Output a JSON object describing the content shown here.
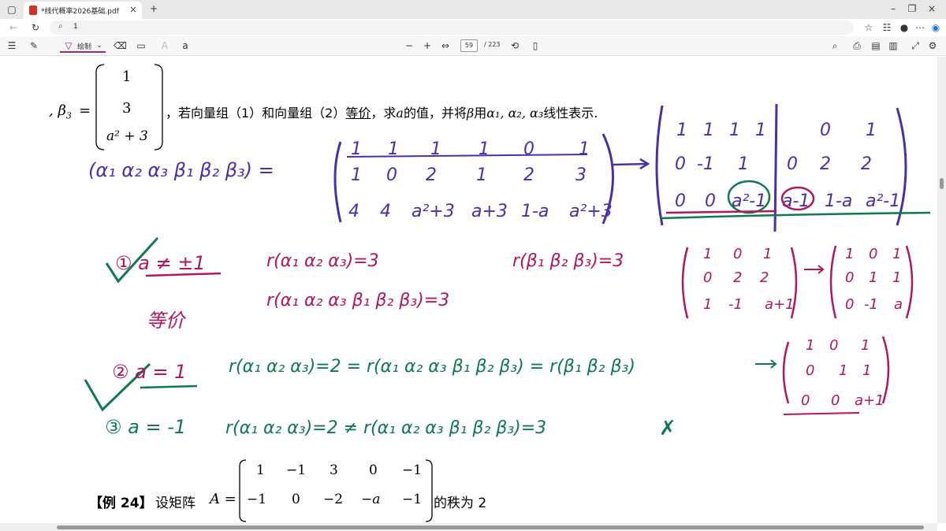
{
  "browser": {
    "tab_title": "*线代概率2026基础.pdf",
    "address": "1"
  },
  "toolbar": {
    "draw_label": "绘制",
    "page_number": "59",
    "page_total": "/ 223"
  },
  "document": {
    "line1_pre": ", β",
    "line1_sub": "3",
    "line1_eq": "=",
    "matrix_beta3": [
      "1",
      "3",
      "a² + 3"
    ],
    "line1_text": "，若向量组（1）和向量组（2）",
    "line1_underlined": "等价",
    "line1_text2": "，求",
    "line1_a": "a",
    "line1_text3": "的值，并将",
    "line1_beta": "β",
    "line1_text4": "用",
    "line1_alphas": "α₁, α₂, α₃",
    "line1_text5": "线性表示.",
    "example_label": "【例 24】",
    "example_text": "设矩阵",
    "example_A": "A =",
    "example_row1": [
      "1",
      "−1",
      "3",
      "0",
      "−1"
    ],
    "example_row2": [
      "−1",
      "0",
      "−2",
      "−a",
      "−1"
    ],
    "example_end": "的秩为 2"
  },
  "handwriting": {
    "blue_lhs": "(α₁ α₂ α₃ β₁ β₂ β₃) =",
    "blue_row1": [
      "1",
      "1",
      "1",
      "1",
      "0",
      "1"
    ],
    "blue_row2": [
      "1",
      "0",
      "2",
      "1",
      "2",
      "3"
    ],
    "blue_row3": [
      "4",
      "4",
      "a²+3",
      "a+3",
      "1-a",
      "a²+3"
    ],
    "ech_row1": [
      "1",
      "1",
      "1",
      "1",
      "0",
      "1"
    ],
    "ech_row2": [
      "0",
      "-1",
      "1",
      "0",
      "2",
      "2"
    ],
    "ech_row3": [
      "0",
      "0",
      "a²-1",
      "a-1",
      "1-a",
      "a²-1"
    ],
    "case1": "① a ≠ ±1",
    "case1_r1": "r(α₁ α₂ α₃)=3",
    "case1_r2": "r(β₁ β₂ β₃)=3",
    "case1_r3": "r(α₁ α₂ α₃ β₁ β₂ β₃)=3",
    "case1_note": "等价",
    "m1_row1": [
      "1",
      "0",
      "1"
    ],
    "m1_row2": [
      "0",
      "2",
      "2"
    ],
    "m1_row3": [
      "1",
      "-1",
      "a+1"
    ],
    "m2_row1": [
      "1",
      "0",
      "1"
    ],
    "m2_row2": [
      "0",
      "1",
      "1"
    ],
    "m2_row3": [
      "0",
      "-1",
      "a"
    ],
    "case2": "② a = 1",
    "case2_eq": "r(α₁ α₂ α₃)=2 = r(α₁ α₂ α₃ β₁ β₂ β₃) = r(β₁ β₂ β₃)",
    "m3_row1": [
      "1",
      "0",
      "1"
    ],
    "m3_row2": [
      "0",
      "1",
      "1"
    ],
    "m3_row3": [
      "0",
      "0",
      "a+1"
    ],
    "case3": "③ a = -1",
    "case3_eq": "r(α₁ α₂ α₃)=2 ≠ r(α₁ α₂ α₃ β₁ β₂ β₃)=3",
    "cross": "✗"
  },
  "colors": {
    "blue_ink": "#4b2fa8",
    "pink_ink": "#b3165f",
    "green_ink": "#0f7a4b"
  }
}
